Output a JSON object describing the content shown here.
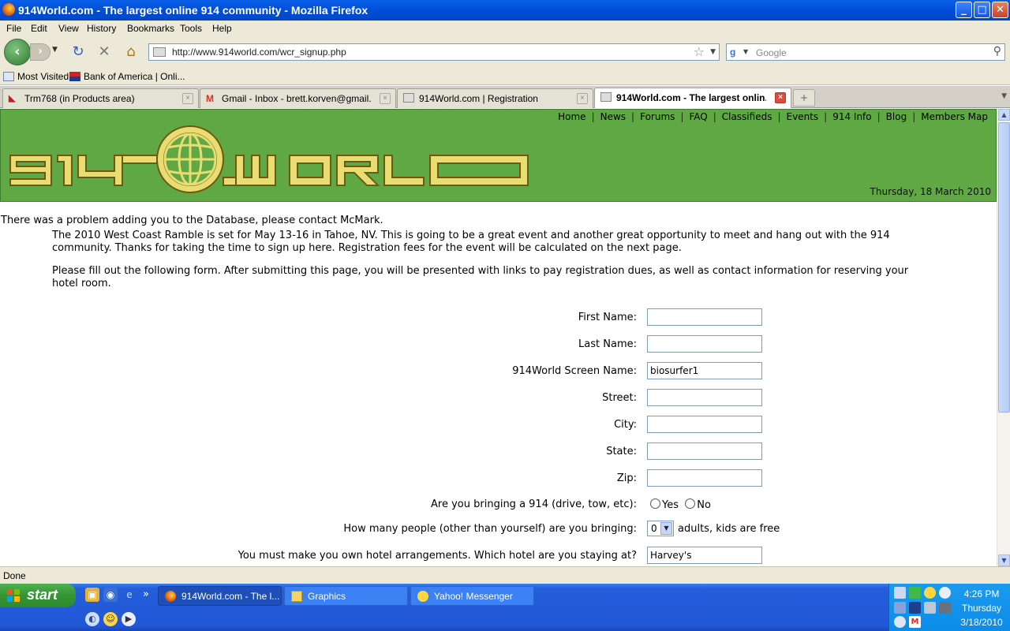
{
  "window": {
    "title": "914World.com - The largest online 914 community - Mozilla Firefox",
    "buttons": {
      "minimize": "_",
      "maximize": "□",
      "close": "✕"
    }
  },
  "menu": [
    "File",
    "Edit",
    "View",
    "History",
    "Bookmarks",
    "Tools",
    "Help"
  ],
  "nav": {
    "url": "http://www.914world.com/wcr_signup.php",
    "search_placeholder": "Google"
  },
  "bookmarks": [
    "Most Visited",
    "Bank of America | Onli..."
  ],
  "tabs": [
    {
      "label": "Trm768 (in Products area)",
      "active": false
    },
    {
      "label": "Gmail - Inbox - brett.korven@gmail.com",
      "active": false
    },
    {
      "label": "914World.com | Registration",
      "active": false
    },
    {
      "label": "914World.com - The largest onlin...",
      "active": true
    }
  ],
  "site": {
    "nav_links": [
      "Home",
      "News",
      "Forums",
      "FAQ",
      "Classifieds",
      "Events",
      "914 Info",
      "Blog",
      "Members Map"
    ],
    "logo_text": "914WORLD",
    "date": "Thursday, 18 March 2010",
    "colors": {
      "header_bg": "#5fa843",
      "logo_gold": "#e8dc72"
    }
  },
  "page": {
    "error": "There was a problem adding you to the Database, please contact McMark.",
    "intro1": "The 2010 West Coast Ramble is set for May 13-16 in Tahoe, NV. This is going to be a great event and another great opportunity to meet and hang out with the 914 community. Thanks for taking the time to sign up here. Registration fees for the event will be calculated on the next page.",
    "intro2": "Please fill out the following form. After submitting this page, you will be presented with links to pay registration dues, as well as contact information for reserving your hotel room."
  },
  "form": {
    "first_name": {
      "label": "First Name:",
      "value": ""
    },
    "last_name": {
      "label": "Last Name:",
      "value": ""
    },
    "screen_name": {
      "label": "914World Screen Name:",
      "value": "biosurfer1"
    },
    "street": {
      "label": "Street:",
      "value": ""
    },
    "city": {
      "label": "City:",
      "value": ""
    },
    "state": {
      "label": "State:",
      "value": ""
    },
    "zip": {
      "label": "Zip:",
      "value": ""
    },
    "bringing_914": {
      "label": "Are you bringing a 914 (drive, tow, etc):",
      "yes": "Yes",
      "no": "No"
    },
    "people": {
      "label": "How many people (other than yourself) are you bringing:",
      "value": "0",
      "suffix": "adults, kids are free"
    },
    "hotel": {
      "label": "You must make you own hotel arrangements. Which hotel are you staying at?",
      "value": "Harvey's"
    }
  },
  "status": "Done",
  "taskbar": {
    "start": "start",
    "windows": [
      {
        "label": "914World.com - The l...",
        "active": true
      },
      {
        "label": "Graphics",
        "active": false
      },
      {
        "label": "Yahoo! Messenger",
        "active": false
      }
    ],
    "overflow": "»",
    "clock": {
      "time": "4:26 PM",
      "day": "Thursday",
      "date": "3/18/2010"
    }
  }
}
